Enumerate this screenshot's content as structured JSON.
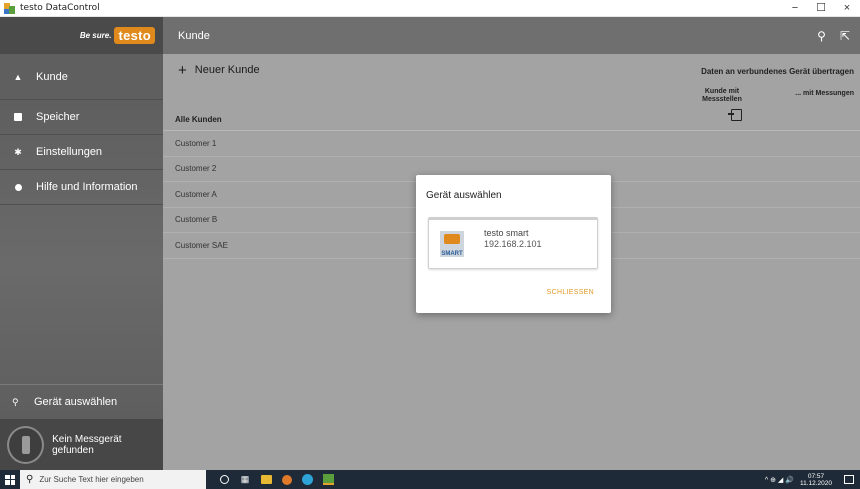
{
  "window": {
    "title": "testo DataControl",
    "minimize": "−",
    "maximize": "☐",
    "close": "×"
  },
  "sidebar": {
    "brand_tagline": "Be sure.",
    "brand_logo": "testo",
    "items": [
      {
        "label": "Kunde",
        "icon": "person-icon",
        "active": true
      },
      {
        "label": "Speicher",
        "icon": "storage-icon"
      },
      {
        "label": "Einstellungen",
        "icon": "gear-icon"
      },
      {
        "label": "Hilfe und Information",
        "icon": "info-icon"
      }
    ],
    "device_select_label": "Gerät auswählen",
    "device_status": "Kein Messgerät gefunden"
  },
  "appbar": {
    "title": "Kunde",
    "search_icon": "search-icon",
    "export_icon": "export-icon"
  },
  "toolbar": {
    "new_customer_label": "Neuer Kunde",
    "transfer_title": "Daten an verbundenes Gerät übertragen",
    "transfer_col1": "Kunde mit Messstellen",
    "transfer_col2": "... mit Messungen"
  },
  "list": {
    "header": "Alle Kunden",
    "customers": [
      "Customer 1",
      "Customer 2",
      "Customer A",
      "Customer B",
      "Customer SAE"
    ]
  },
  "dialog": {
    "title": "Gerät auswählen",
    "device_name": "testo smart",
    "device_ip": "192.168.2.101",
    "device_badge": "SMART",
    "close_label": "SCHLIESSEN"
  },
  "taskbar": {
    "search_placeholder": "Zur Suche Text hier eingeben",
    "time": "07:57",
    "date": "11.12.2020",
    "tray_icons": "^ ⊕ ◢ 🔊"
  },
  "colors": {
    "accent": "#e08a1e",
    "sidebar": "#5f5f5f",
    "appbar": "#6f6f6f",
    "overlay": "#a3a3a3",
    "taskbar": "#1e2a38"
  }
}
